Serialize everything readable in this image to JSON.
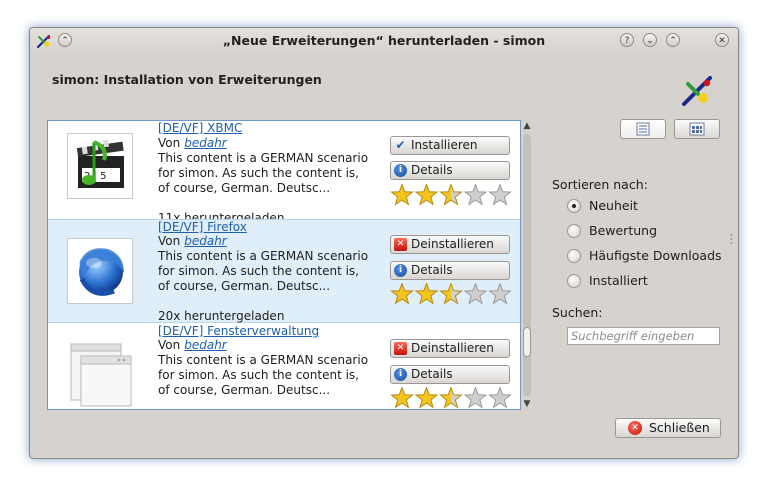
{
  "window": {
    "title": "„Neue Erweiterungen“ herunterladen - simon",
    "buttons": {
      "keep_above": "⌃",
      "help": "?",
      "minimize": "⌄",
      "maximize": "⌃",
      "close": "✕"
    }
  },
  "header": {
    "heading": "simon: Installation von Erweiterungen"
  },
  "items": [
    {
      "title": "[DE/VF] XBMC",
      "by_label": "Von",
      "author": "bedahr",
      "description": "This content is a GERMAN scenario for simon. As such the content is, of course, German. Deutsc...",
      "downloads": "11x heruntergeladen",
      "action_label": "Installieren",
      "details_label": "Details",
      "rating_stars": 2.5,
      "icon": "film-clapper-icon"
    },
    {
      "title": "[DE/VF] Firefox",
      "by_label": "Von",
      "author": "bedahr",
      "description": "This content is a GERMAN scenario for simon. As such the content is, of course, German. Deutsc...",
      "downloads": "20x heruntergeladen",
      "action_label": "Deinstallieren",
      "details_label": "Details",
      "rating_stars": 2.5,
      "icon": "firefox-globe-icon"
    },
    {
      "title": "[DE/VF] Fensterverwaltung",
      "by_label": "Von",
      "author": "bedahr",
      "description": "This content is a GERMAN scenario for simon. As such the content is, of course, German. Deutsc...",
      "downloads": "",
      "action_label": "Deinstallieren",
      "details_label": "Details",
      "rating_stars": 2.5,
      "icon": "windows-stack-icon"
    }
  ],
  "sort": {
    "label": "Sortieren nach:",
    "options": [
      "Neuheit",
      "Bewertung",
      "Häufigste Downloads",
      "Installiert"
    ],
    "selected": "Neuheit"
  },
  "search": {
    "label": "Suchen:",
    "placeholder": "Suchbegriff eingeben",
    "value": ""
  },
  "footer": {
    "close_label": "Schließen"
  },
  "colors": {
    "link": "#1f5fad",
    "selection": "#dfeef9",
    "list_border": "#6e99c8",
    "window_bg": "#d6d2cd"
  }
}
